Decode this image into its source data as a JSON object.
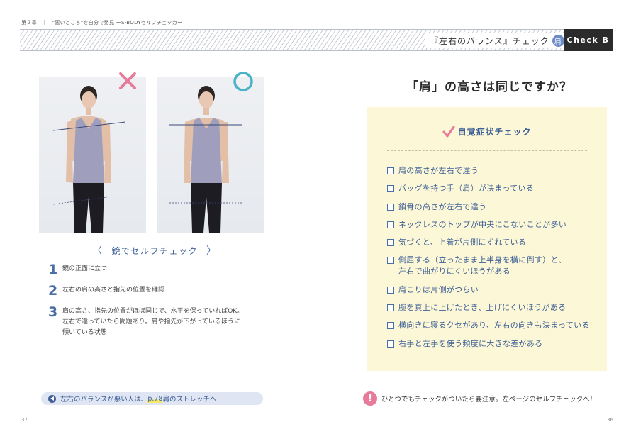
{
  "header": {
    "chapter": "第２章　｜　\"悪いところ\"を自分で発見 ーS-BODYセルフチェッカー",
    "section_title": "『左右のバランス』チェック",
    "section_badge": "肩",
    "check_label": "Check B"
  },
  "left": {
    "mirror_title": "鏡でセルフチェック",
    "bracket_left": "〈",
    "bracket_right": "〉",
    "steps": [
      {
        "num": "1",
        "text": "鏡の正面に立つ"
      },
      {
        "num": "2",
        "text": "左右の肩の高さと指先の位置を確認"
      },
      {
        "num": "3",
        "text": "肩の高さ、指先の位置がほぼ同じで、水平を保っていればOK。\n左右で違っていたら問題あり。肩や指先が下がっているほうに\n傾いている状態"
      }
    ],
    "link_pre": "左右のバランスが悪い人は、",
    "link_page": "p.78",
    "link_post": " 肩のストレッチへ",
    "page_number": "37"
  },
  "right": {
    "question": "「肩」の高さは同じですか？",
    "panel_title": "自覚症状チェック",
    "checklist": [
      "肩の高さが左右で違う",
      "バッグを持つ手（肩）が決まっている",
      "鎖骨の高さが左右で違う",
      "ネックレスのトップが中央にこないことが多い",
      "気づくと、上着が片側にずれている",
      "側屈する（立ったまま上半身を横に倒す）と、\n左右で曲がりにくいほうがある",
      "肩こりは片側がつらい",
      "腕を真上に上げたとき、上げにくいほうがある",
      "横向きに寝るクセがあり、左右の向きも決まっている",
      "右手と左手を使う頻度に大きな差がある"
    ],
    "warning_mark": "!",
    "warning_underlined": "ひとつでもチェック",
    "warning_rest": "がついたら要注意。左ページのセルフチェックへ！",
    "page_number": "36"
  },
  "colors": {
    "accent_blue": "#4a6fa5",
    "pink": "#e87a9a",
    "teal": "#4bb3c8",
    "panel_bg": "#fcf7d6"
  }
}
